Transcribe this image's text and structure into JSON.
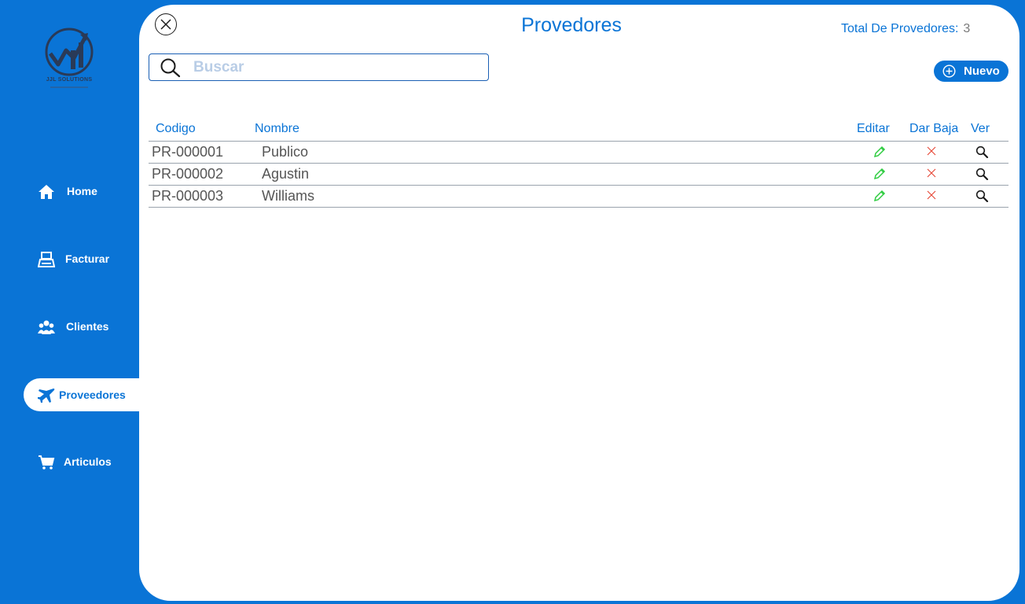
{
  "sidebar": {
    "logo_text": "JJL SOLUTIONS",
    "items": [
      {
        "label": "Home",
        "icon": "home-icon"
      },
      {
        "label": "Facturar",
        "icon": "register-icon"
      },
      {
        "label": "Clientes",
        "icon": "users-icon"
      },
      {
        "label": "Proveedores",
        "icon": "airplane-icon",
        "active": true
      },
      {
        "label": "Articulos",
        "icon": "cart-icon"
      }
    ]
  },
  "header": {
    "title": "Provedores",
    "total_label": "Total De Provedores:",
    "total_value": "3"
  },
  "search": {
    "placeholder": "Buscar"
  },
  "toolbar": {
    "new_label": "Nuevo"
  },
  "table": {
    "columns": {
      "code": "Codigo",
      "name": "Nombre",
      "edit": "Editar",
      "delete": "Dar Baja",
      "view": "Ver"
    },
    "rows": [
      {
        "code": "PR-000001",
        "name": "Publico"
      },
      {
        "code": "PR-000002",
        "name": "Agustin"
      },
      {
        "code": "PR-000003",
        "name": "Williams"
      }
    ]
  },
  "colors": {
    "brand_blue": "#0a74d6",
    "edit_green": "#2ecc40",
    "delete_red": "#e74c3c"
  }
}
